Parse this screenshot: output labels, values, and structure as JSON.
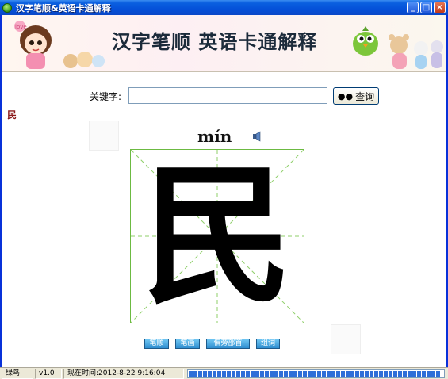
{
  "window": {
    "title": "汉字笔顺&英语卡通解释"
  },
  "banner": {
    "title": "汉字笔顺 英语卡通解释"
  },
  "search": {
    "label": "关键字:",
    "value": "",
    "button_label": "查询"
  },
  "current_char": {
    "label": "民",
    "pinyin": "mín",
    "glyph": "民"
  },
  "actions": [
    {
      "label": "笔顺"
    },
    {
      "label": "笔画"
    },
    {
      "label": "偏旁部首"
    },
    {
      "label": "组词"
    }
  ],
  "status": {
    "app": "绿鸟",
    "version": "v1.0",
    "time": "现在时间:2012-8-22 9:16:04",
    "progress": 1.0
  },
  "colors": {
    "titlebar": "#0a5fe0",
    "grid": "#6cba42",
    "char_label": "#8b1a1a"
  },
  "icons": [
    "app-icon",
    "minimize-icon",
    "maximize-icon",
    "close-icon",
    "binoculars-icon",
    "speaker-icon"
  ]
}
